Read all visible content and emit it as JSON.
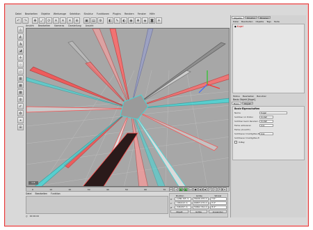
{
  "menubar": {
    "items": [
      "Datei",
      "Bearbeiten",
      "Objekte",
      "Werkzeuge",
      "Selektion",
      "Struktur",
      "Funktionen",
      "Plugins",
      "Rendern",
      "Fenster",
      "Hilfe"
    ]
  },
  "viewport": {
    "menu": [
      "Ansicht",
      "Bearbeiten",
      "Kameras",
      "Darstellung",
      "Ansicht"
    ],
    "badge": "0 B"
  },
  "timeline": {
    "start": "0",
    "ticks": [
      "10",
      "20",
      "30",
      "40",
      "50",
      "60",
      "70",
      "80",
      "90"
    ],
    "end": "0 B"
  },
  "materials": {
    "menu": [
      "Datei",
      "Bearbeiten",
      "Funktion"
    ],
    "status": "00:00:00"
  },
  "coordinates": {
    "headers": [
      "Position",
      "Größe",
      "Winkel"
    ],
    "rows": [
      {
        "label": "X",
        "pos": "-1286.345 m",
        "size": "76626.476 m",
        "angle": "H 0°"
      },
      {
        "label": "Y",
        "pos": "-168.613 m",
        "size": "16803.176 m",
        "angle": "P 0°"
      },
      {
        "label": "Z",
        "pos": "-348.657 m",
        "size": "72862.742 m",
        "angle": "B 0°"
      }
    ],
    "mode_label": "Objekt",
    "size_mode_label": "Größe",
    "apply_label": "Anwenden"
  },
  "right_panel": {
    "tabs": [
      "Objekte",
      "Struktur",
      "Browser"
    ],
    "menu": [
      "Datei",
      "Bearbeiten",
      "Objekte",
      "Tags",
      "Texte"
    ],
    "object_name": "Kugel",
    "attr_menu": [
      "Modus",
      "Bearbeiten",
      "Benutzer"
    ],
    "attr_tabs": [
      "Basis",
      "Objekt"
    ],
    "attr_header": "Basis-Objekt [Kugel]",
    "attr_title": "Basis-Eigenschaften",
    "attr_rows": [
      {
        "label": "Name",
        "value": "Kugel",
        "type": "wide"
      },
      {
        "label": "Sichtbar im Editor",
        "value": "Undef.",
        "type": "select"
      },
      {
        "label": "Sichtbar beim Rendern",
        "value": "Undef.",
        "type": "select"
      },
      {
        "label": "Farbe aktivieren",
        "value": "Aus",
        "type": "select"
      },
      {
        "label": "Farbe (Ansicht)",
        "value": "",
        "type": "dim"
      },
      {
        "label": "Sichtbarer Drahtgitter-Modus",
        "value": "Aus",
        "type": "select"
      },
      {
        "label": "Sichtbarer Drahtgitter-Farbe",
        "value": "",
        "type": "dim"
      },
      {
        "label": "X-Ray",
        "value": "",
        "type": "check"
      }
    ]
  },
  "colors": {
    "accent_red": "#e03b3b",
    "shard_red": "#ff4a4a",
    "shard_cyan": "#36e0e0",
    "viewport_bg": "#a7a7a7"
  }
}
